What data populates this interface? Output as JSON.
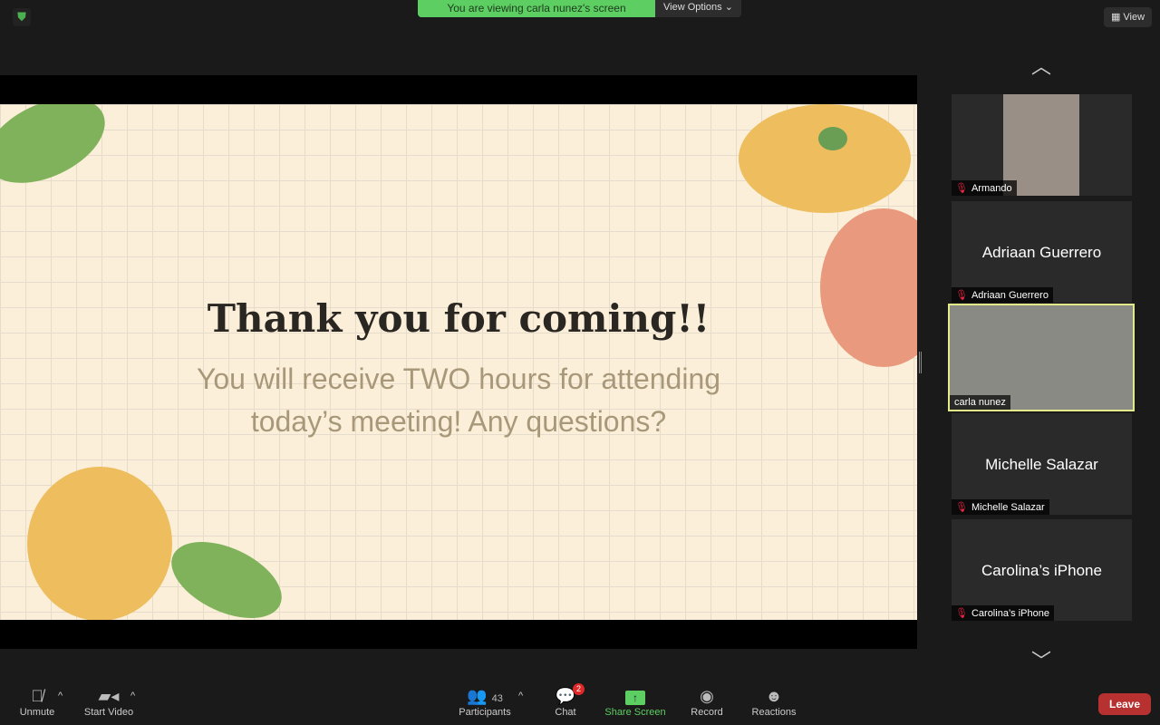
{
  "banner": {
    "text": "You are viewing carla nunez's screen",
    "view_options": "View Options ⌄"
  },
  "view_button": "View",
  "slide": {
    "title": "Thank you for coming!!",
    "subtitle": "You will receive TWO hours for attending today’s meeting! Any questions?"
  },
  "participants_tiles": [
    {
      "name": "Armando",
      "video": true,
      "muted": true
    },
    {
      "name": "Adriaan Guerrero",
      "video": false,
      "muted": true
    },
    {
      "name": "carla nunez",
      "video": true,
      "muted": false,
      "active_speaker": true
    },
    {
      "name": "Michelle Salazar",
      "video": false,
      "muted": true
    },
    {
      "name": "Carolina’s iPhone",
      "video": false,
      "muted": true
    }
  ],
  "toolbar": {
    "unmute": "Unmute",
    "start_video": "Start Video",
    "participants": "Participants",
    "participants_count": "43",
    "chat": "Chat",
    "chat_badge": "2",
    "share_screen": "Share Screen",
    "record": "Record",
    "reactions": "Reactions",
    "leave": "Leave"
  },
  "colors": {
    "banner": "#5dcf62",
    "leave": "#b83131",
    "active_border": "#e3ea8a"
  }
}
